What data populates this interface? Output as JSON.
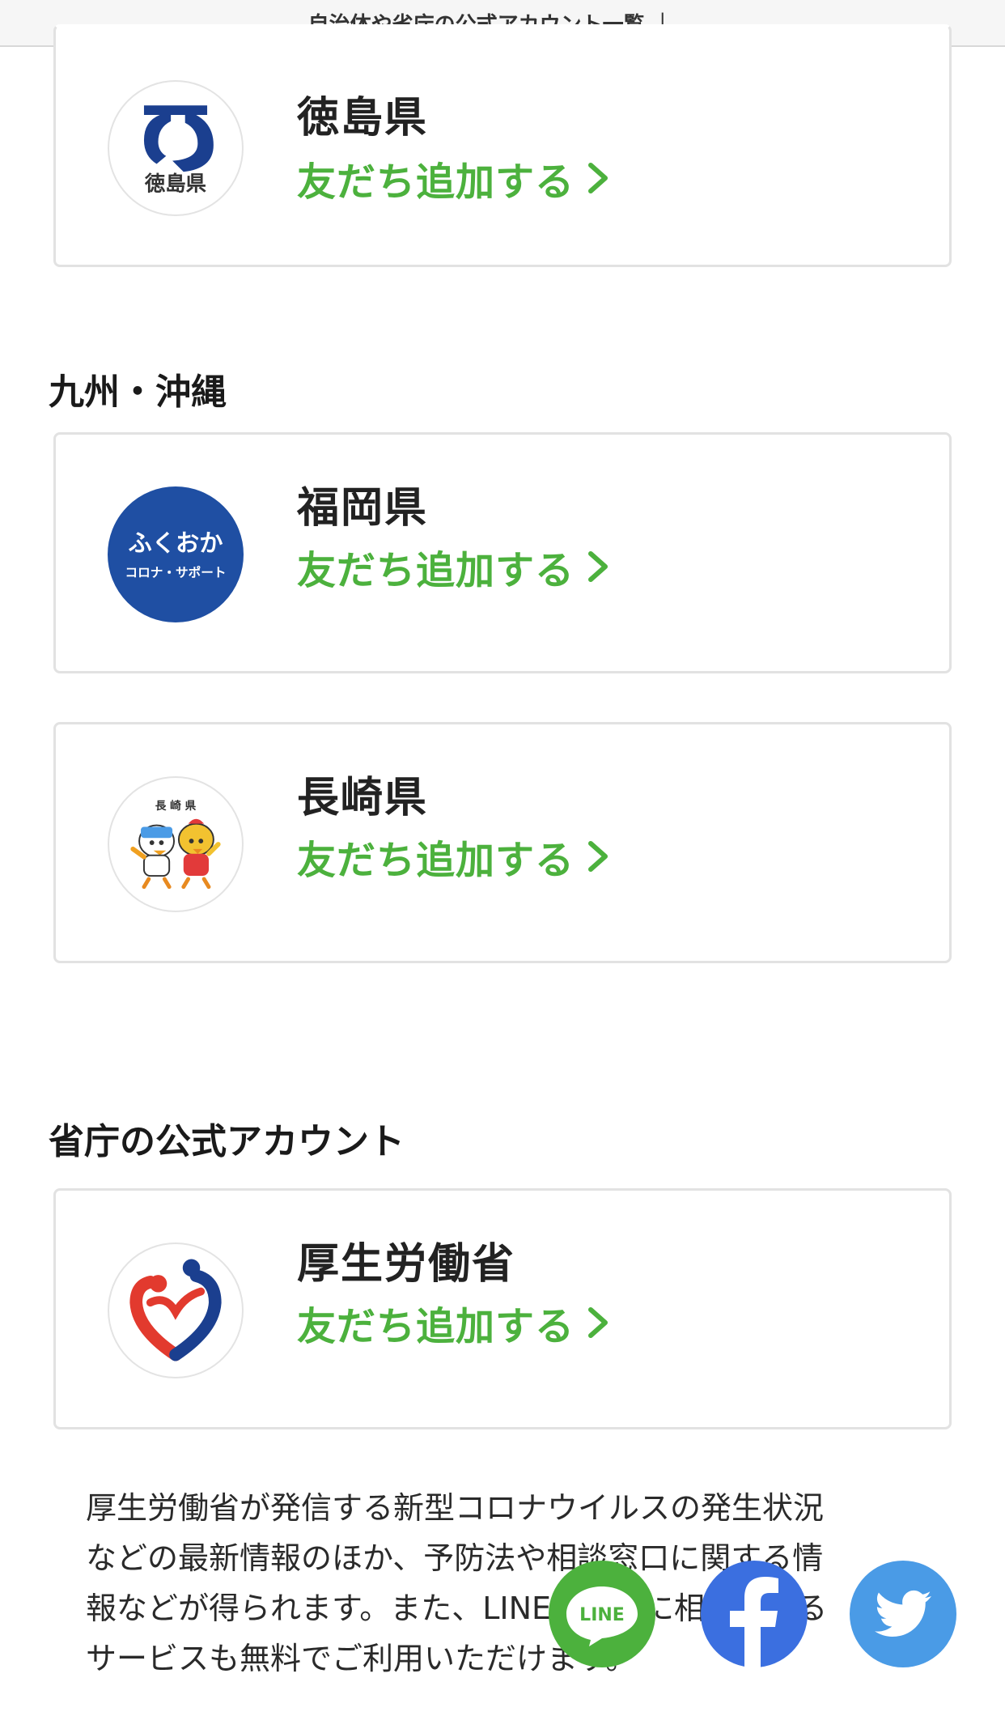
{
  "browser": {
    "title": "自治体や省庁の公式アカウント一覧 ｜..."
  },
  "cards": {
    "tokushima": {
      "name": "徳島県",
      "add_label": "友だち追加する",
      "logo_text": "徳島県"
    },
    "fukuoka": {
      "name": "福岡県",
      "add_label": "友だち追加する",
      "logo_text_top": "ふくおか",
      "logo_text_bottom": "コロナ・サポート"
    },
    "nagasaki": {
      "name": "長崎県",
      "add_label": "友だち追加する",
      "logo_text": "長 崎 県"
    },
    "mhlw": {
      "name": "厚生労働省",
      "add_label": "友だち追加する"
    }
  },
  "sections": {
    "kyushu": "九州・沖縄",
    "ministries": "省庁の公式アカウント"
  },
  "description": {
    "line1": "厚生労働省が発信する新型コロナウイルスの発生状況",
    "line2": "などの最新情報のほか、予防法や相談窓口に関する情",
    "line3": "報などが得られます。また、LINEで医師に相談できる",
    "line4": "サービスも無料でご利用いただけます。"
  },
  "share": {
    "line_label": "LINE"
  },
  "colors": {
    "accent_green": "#4cb13d",
    "facebook_blue": "#3b6fe0",
    "twitter_blue": "#4a9be6",
    "fukuoka_blue": "#1f4fa3"
  }
}
